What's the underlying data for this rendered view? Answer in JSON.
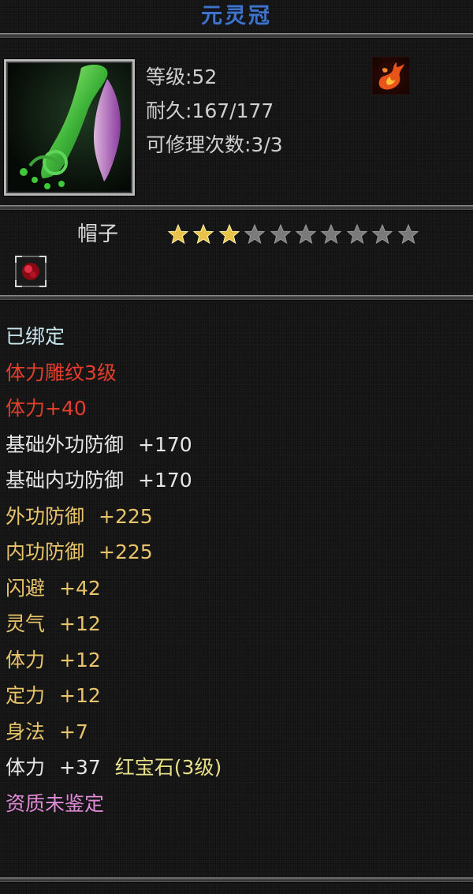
{
  "item": {
    "name": "元灵冠",
    "level": "等级:52",
    "durability": "耐久:167/177",
    "repair": "可修理次数:3/3",
    "slot": "帽子",
    "stars_total": 10,
    "stars_filled": 3
  },
  "properties": [
    {
      "text": "已绑定",
      "cls": "c-bound"
    },
    {
      "text": "体力雕纹3级",
      "cls": "c-red"
    },
    {
      "text": "体力+40",
      "cls": "c-red"
    },
    {
      "text": "基础外功防御",
      "value": "+170",
      "cls": "c-base"
    },
    {
      "text": "基础内功防御",
      "value": "+170",
      "cls": "c-base"
    },
    {
      "text": "外功防御",
      "value": "+225",
      "cls": "c-gold"
    },
    {
      "text": "内功防御",
      "value": "+225",
      "cls": "c-gold"
    },
    {
      "text": "闪避",
      "value": "+42",
      "cls": "c-gold"
    },
    {
      "text": "灵气",
      "value": "+12",
      "cls": "c-gold"
    },
    {
      "text": "体力",
      "value": "+12",
      "cls": "c-gold"
    },
    {
      "text": "定力",
      "value": "+12",
      "cls": "c-gold"
    },
    {
      "text": "身法",
      "value": "+7",
      "cls": "c-gold"
    }
  ],
  "gem_line": {
    "stat": "体力",
    "value": "+37",
    "gem": "红宝石(3级)"
  },
  "quality": "资质未鉴定",
  "icons": {
    "item": "hat-item-icon",
    "school": "fire-emblem-icon",
    "gem_socket": "ruby-socket-icon",
    "star_filled": "star-filled-icon",
    "star_empty": "star-empty-icon"
  },
  "colors": {
    "title": "#3f73c8",
    "bound": "#c8e6ec",
    "engrave": "#e43e2c",
    "base": "#e6e6e6",
    "attr": "#e8c46a",
    "gem": "#e7e08a",
    "quality": "#e08ad8"
  }
}
